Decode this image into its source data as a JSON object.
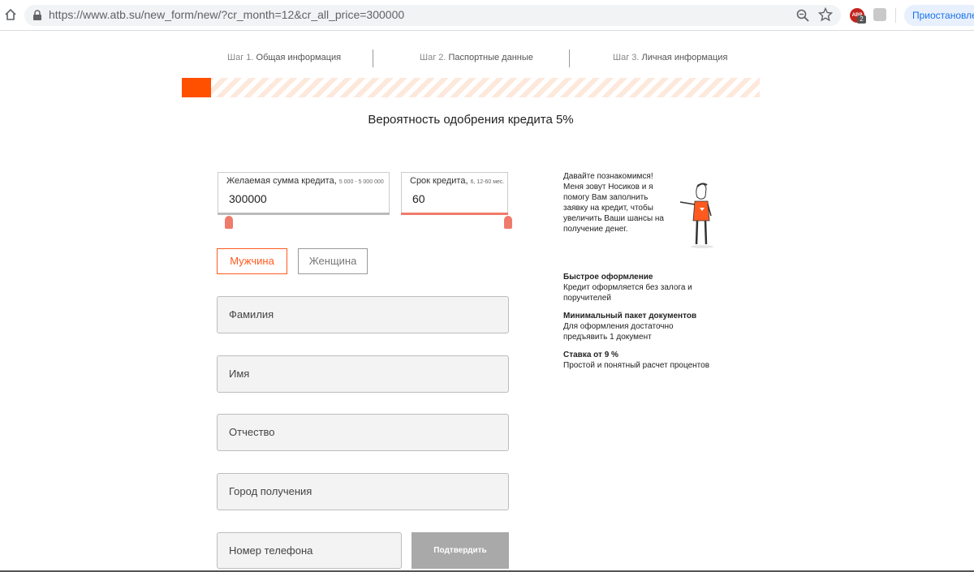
{
  "browser": {
    "url": "https://www.atb.su/new_form/new/?cr_month=12&cr_all_price=300000",
    "abp_count": "2",
    "abp_label": "ABP",
    "paused_label": "Приостановлено"
  },
  "steps": [
    {
      "prefix": "Шаг 1.",
      "label": "Общая информация"
    },
    {
      "prefix": "Шаг 2.",
      "label": "Паспортные данные"
    },
    {
      "prefix": "Шаг 3.",
      "label": "Личная информация"
    }
  ],
  "progress": {
    "fraction": 0.05,
    "fill_color": "#ff5000"
  },
  "probability_text": "Вероятность одобрения кредита 5%",
  "amount": {
    "label": "Желаемая сумма кредита,",
    "hint": "5 000 - 5 000 000",
    "value": "300000"
  },
  "term": {
    "label": "Срок кредита,",
    "hint": "6, 12-60 мес.",
    "value": "60"
  },
  "gender": {
    "male": "Мужчина",
    "female": "Женщина"
  },
  "fields": {
    "surname": "Фамилия",
    "name": "Имя",
    "patronymic": "Отчество",
    "city": "Город получения",
    "phone": "Номер телефона"
  },
  "confirm_label": "Подтвердить",
  "intro_text": "Давайте познакомимся! Меня зовут Носиков и я помогу Вам заполнить заявку на кредит, чтобы увеличить Ваши шансы на получение денег.",
  "benefits": [
    {
      "title": "Быстрое оформление",
      "text": "Кредит оформляется без залога и поручителей"
    },
    {
      "title": "Минимальный пакет документов",
      "text": "Для оформления достаточно предъявить 1 документ"
    },
    {
      "title": "Ставка от 9 %",
      "text": "Простой и понятный расчет процентов"
    }
  ],
  "colors": {
    "accent": "#ff5a1f",
    "handle": "#ef7b6a",
    "disabled": "#a9a9a9"
  }
}
